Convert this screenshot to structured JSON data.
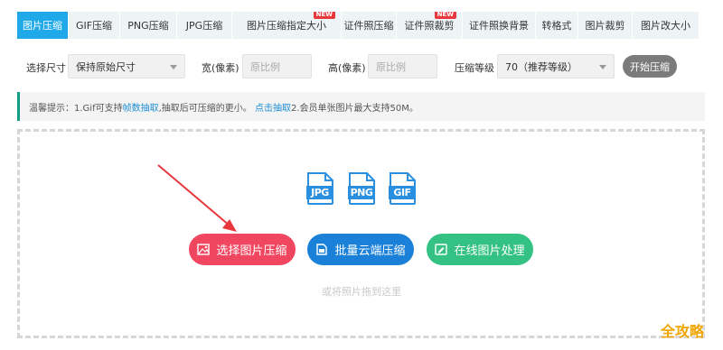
{
  "tabs": [
    {
      "label": "图片压缩",
      "active": true,
      "new": false
    },
    {
      "label": "GIF压缩",
      "active": false,
      "new": false
    },
    {
      "label": "PNG压缩",
      "active": false,
      "new": false
    },
    {
      "label": "JPG压缩",
      "active": false,
      "new": false
    },
    {
      "label": "图片压缩指定大小",
      "active": false,
      "new": true
    },
    {
      "label": "证件照压缩",
      "active": false,
      "new": false
    },
    {
      "label": "证件照裁剪",
      "active": false,
      "new": true
    },
    {
      "label": "证件照换背景",
      "active": false,
      "new": false
    },
    {
      "label": "转格式",
      "active": false,
      "new": false
    },
    {
      "label": "图片裁剪",
      "active": false,
      "new": false
    },
    {
      "label": "图片改大小",
      "active": false,
      "new": false
    }
  ],
  "new_badge": "NEW",
  "options": {
    "size_label": "选择尺寸",
    "size_value": "保持原始尺寸",
    "width_label": "宽(像素)",
    "width_placeholder": "原比例",
    "height_label": "高(像素)",
    "height_placeholder": "原比例",
    "level_label": "压缩等级",
    "level_value": "70（推荐等级）",
    "start_button": "开始压缩"
  },
  "notice": {
    "prefix": "温馨提示：1.Gif可支持",
    "link1": "帧数抽取",
    "middle": ",抽取后可压缩的更小。",
    "link2": "点击抽取",
    "suffix": " 2.会员单张图片最大支持50M。"
  },
  "formats": [
    "JPG",
    "PNG",
    "GIF"
  ],
  "actions": {
    "select": "选择图片压缩",
    "batch": "批量云端压缩",
    "online": "在线图片处理"
  },
  "drop_hint": "或将照片拖到这里",
  "watermark": "全攻略",
  "colors": {
    "tab_active": "#1fa9e8",
    "red_button": "#f04660",
    "blue_button": "#1a80d8",
    "green_button": "#33c283",
    "file_icon": "#2b8fe0"
  }
}
